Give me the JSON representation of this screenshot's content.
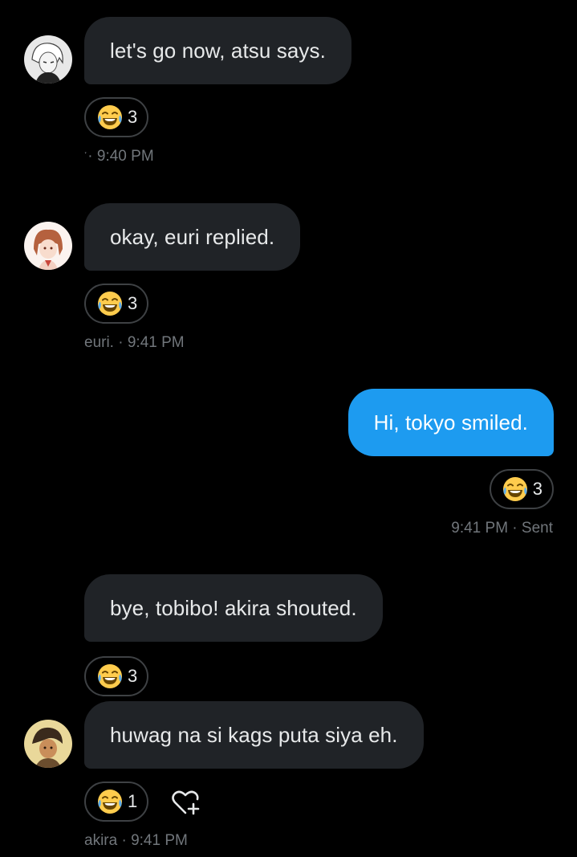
{
  "messages": [
    {
      "text": "let's go now, atsu says.",
      "reaction": {
        "emoji": "joy",
        "count": "3"
      },
      "meta": "ˑ· 9:40 PM"
    },
    {
      "text": "okay, euri replied.",
      "reaction": {
        "emoji": "joy",
        "count": "3"
      },
      "meta": "euri. · 9:41 PM"
    },
    {
      "text": "Hi, tokyo smiled.",
      "reaction": {
        "emoji": "joy",
        "count": "3"
      },
      "meta": "9:41 PM · Sent"
    },
    {
      "text": "bye, tobibo! akira shouted.",
      "reaction": {
        "emoji": "joy",
        "count": "3"
      }
    },
    {
      "text": "huwag na si kags puta siya eh.",
      "reaction": {
        "emoji": "joy",
        "count": "1"
      },
      "meta": "akira · 9:41 PM"
    }
  ],
  "icons": {
    "reaction_emoji": "face-with-tears-of-joy-icon",
    "add_reaction": "heart-plus-icon"
  },
  "colors": {
    "background": "#000000",
    "received_bubble": "#202327",
    "sent_bubble": "#1d9bf0",
    "meta_text": "#71767b"
  }
}
